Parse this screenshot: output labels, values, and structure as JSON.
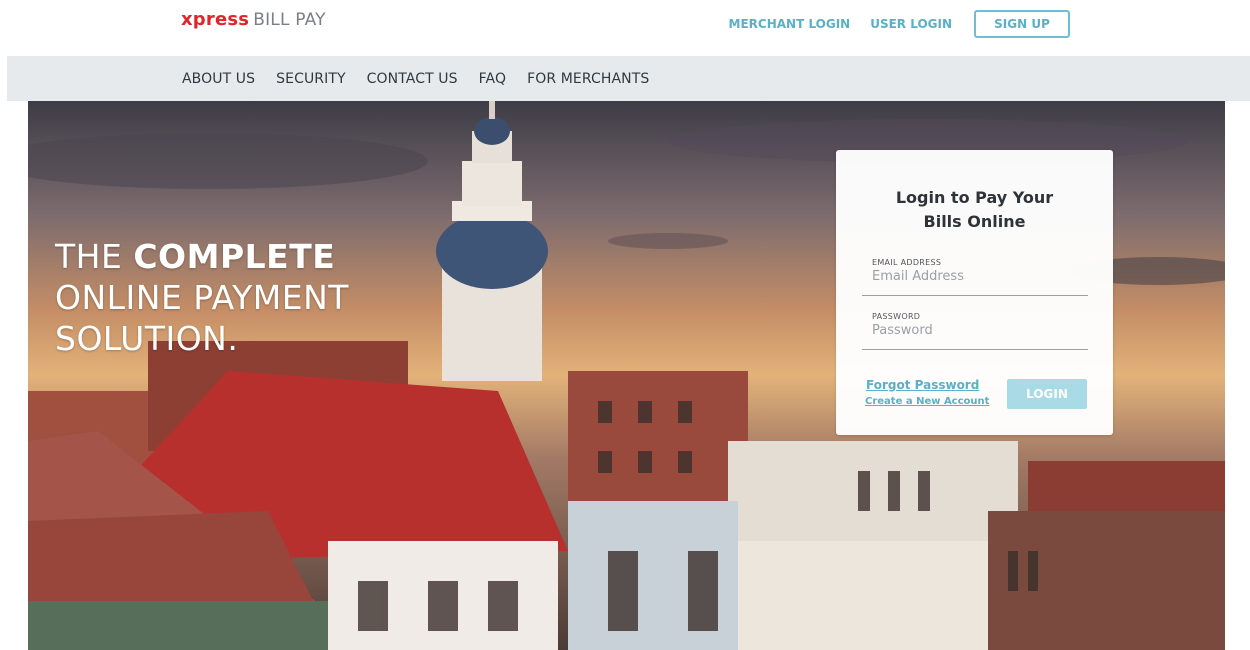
{
  "header": {
    "logo_brand": "xpress",
    "logo_rest": "BILL PAY",
    "links": {
      "merchant_login": "MERCHANT LOGIN",
      "user_login": "USER LOGIN",
      "sign_up": "SIGN UP"
    }
  },
  "nav": {
    "items": [
      "ABOUT US",
      "SECURITY",
      "CONTACT US",
      "FAQ",
      "FOR MERCHANTS"
    ]
  },
  "hero": {
    "tagline_line1_prefix": "THE",
    "tagline_line1_bold": "COMPLETE",
    "tagline_line2": "ONLINE PAYMENT",
    "tagline_line3": "SOLUTION."
  },
  "login": {
    "title_line1": "Login to Pay Your",
    "title_line2": "Bills Online",
    "email_label": "EMAIL ADDRESS",
    "email_placeholder": "Email Address",
    "email_value": "",
    "password_label": "PASSWORD",
    "password_placeholder": "Password",
    "password_value": "",
    "forgot_password": "Forgot Password",
    "create_account": "Create a New Account",
    "login_button": "LOGIN"
  },
  "colors": {
    "brand_red": "#e0262b",
    "accent_teal": "#5ab0c6",
    "nav_bg": "#e7eaec",
    "login_button": "#a9dbe7"
  }
}
